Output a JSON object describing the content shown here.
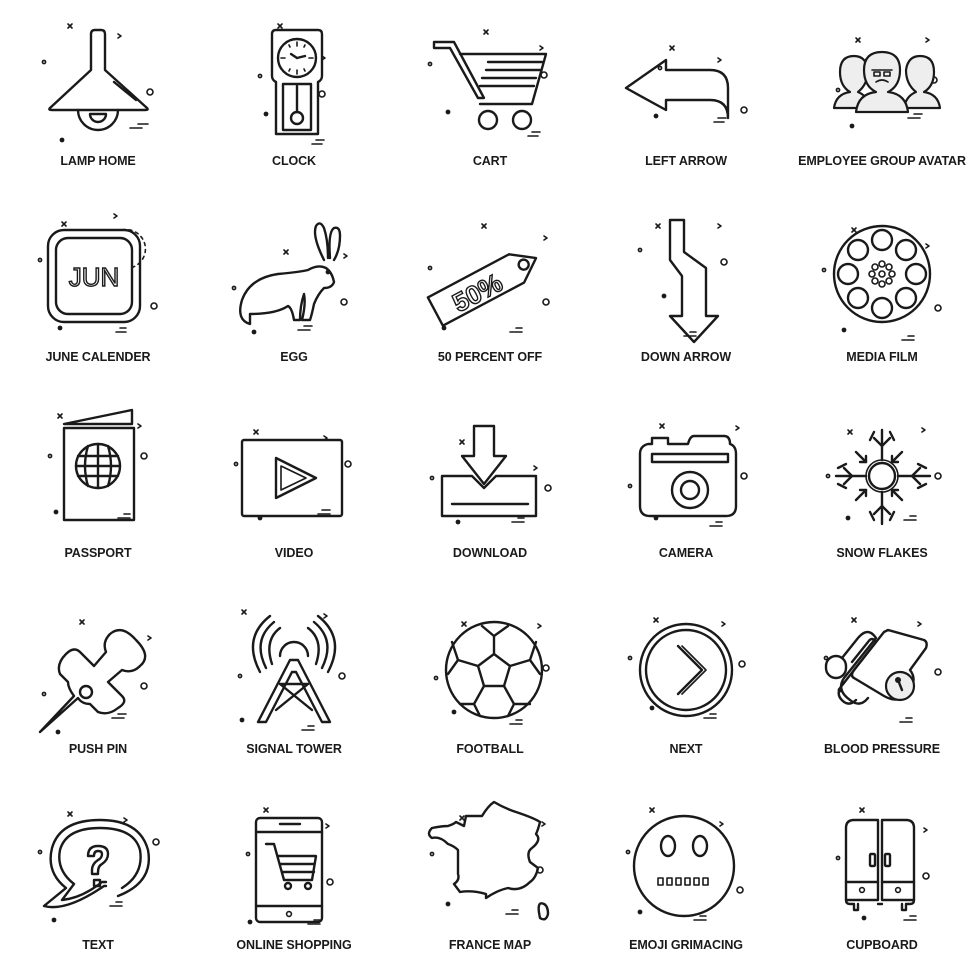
{
  "icons": [
    {
      "label": "LAMP HOME",
      "icon": "lamp-icon"
    },
    {
      "label": "CLOCK",
      "icon": "pendulum-clock-icon"
    },
    {
      "label": "CART",
      "icon": "shopping-cart-icon"
    },
    {
      "label": "LEFT ARROW",
      "icon": "left-arrow-icon"
    },
    {
      "label": "EMPLOYEE GROUP AVATAR",
      "icon": "employee-group-icon"
    },
    {
      "label": "JUNE CALENDER",
      "icon": "june-calendar-icon",
      "text": "JUN"
    },
    {
      "label": "EGG",
      "icon": "rabbit-icon"
    },
    {
      "label": "50 PERCENT OFF",
      "icon": "discount-tag-icon",
      "text": "50%"
    },
    {
      "label": "DOWN ARROW",
      "icon": "down-arrow-icon"
    },
    {
      "label": "MEDIA FILM",
      "icon": "film-reel-icon"
    },
    {
      "label": "PASSPORT",
      "icon": "passport-icon"
    },
    {
      "label": "VIDEO",
      "icon": "video-play-icon"
    },
    {
      "label": "DOWNLOAD",
      "icon": "download-icon"
    },
    {
      "label": "CAMERA",
      "icon": "camera-icon"
    },
    {
      "label": "SNOW FLAKES",
      "icon": "snowflake-icon"
    },
    {
      "label": "PUSH PIN",
      "icon": "push-pin-icon"
    },
    {
      "label": "SIGNAL TOWER",
      "icon": "signal-tower-icon"
    },
    {
      "label": "FOOTBALL",
      "icon": "football-icon"
    },
    {
      "label": "NEXT",
      "icon": "next-chevron-icon"
    },
    {
      "label": "BLOOD PRESSURE",
      "icon": "blood-pressure-icon"
    },
    {
      "label": "TEXT",
      "icon": "question-speech-bubble-icon"
    },
    {
      "label": "ONLINE SHOPPING",
      "icon": "mobile-cart-icon"
    },
    {
      "label": "FRANCE MAP",
      "icon": "france-map-icon"
    },
    {
      "label": "EMOJI GRIMACING",
      "icon": "grimacing-face-icon"
    },
    {
      "label": "CUPBOARD",
      "icon": "cupboard-icon"
    }
  ],
  "colors": {
    "stroke": "#1a1a1a",
    "background": "#ffffff"
  }
}
